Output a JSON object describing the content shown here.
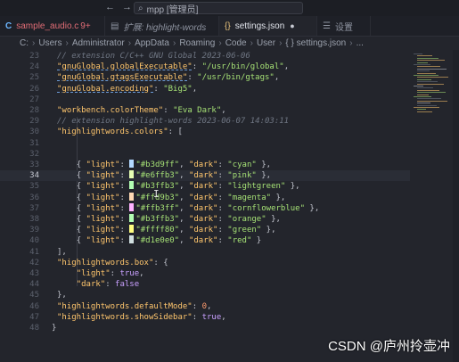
{
  "titlebar": {
    "nav_back": "←",
    "nav_forward": "→",
    "search_icon": "search-icon",
    "search_text": "mpp [管理员]"
  },
  "tabs": [
    {
      "label": "sample_audio.c",
      "badge": "9+",
      "icon": "c-file-icon",
      "color": "#e06c75"
    },
    {
      "label": "扩展: highlight-words",
      "icon": "extension-icon",
      "italic": true
    },
    {
      "label": "settings.json",
      "icon": "json-icon",
      "modified": "●",
      "active": true
    },
    {
      "label": "设置",
      "icon": "settings-icon"
    }
  ],
  "breadcrumb": [
    "C:",
    "Users",
    "Administrator",
    "AppData",
    "Roaming",
    "Code",
    "User",
    "{ } settings.json",
    "..."
  ],
  "colors": {
    "key": "#ffc66d",
    "string": "#a5e075",
    "comment": "#6f7683",
    "number": "#ff9d6e",
    "keyword": "#c9a0ff",
    "background": "#23252c"
  },
  "lines": [
    {
      "n": "23",
      "parts": [
        {
          "t": "// extension C/C++ GNU Global 2023-06-06",
          "c": "com"
        }
      ]
    },
    {
      "n": "24",
      "parts": [
        {
          "t": "\"gnuGlobal.globalExecutable\"",
          "c": "key"
        },
        {
          "t": ": ",
          "c": "punc"
        },
        {
          "t": "\"/usr/bin/global\"",
          "c": "str"
        },
        {
          "t": ",",
          "c": "punc"
        }
      ]
    },
    {
      "n": "25",
      "parts": [
        {
          "t": "\"gnuGlobal.gtagsExecutable\"",
          "c": "key"
        },
        {
          "t": ": ",
          "c": "punc"
        },
        {
          "t": "\"/usr/bin/gtags\"",
          "c": "str"
        },
        {
          "t": ",",
          "c": "punc"
        }
      ]
    },
    {
      "n": "26",
      "parts": [
        {
          "t": "\"gnuGlobal.encoding\"",
          "c": "key"
        },
        {
          "t": ": ",
          "c": "punc"
        },
        {
          "t": "\"Big5\"",
          "c": "str"
        },
        {
          "t": ",",
          "c": "punc"
        }
      ]
    },
    {
      "n": "27",
      "parts": []
    },
    {
      "n": "28",
      "parts": [
        {
          "t": "\"workbench.colorTheme\"",
          "c": "key"
        },
        {
          "t": ": ",
          "c": "punc"
        },
        {
          "t": "\"Eva Dark\"",
          "c": "str"
        },
        {
          "t": ",",
          "c": "punc"
        }
      ]
    },
    {
      "n": "29",
      "parts": [
        {
          "t": "// extension highlight-words 2023-06-07 14:03:11",
          "c": "com"
        }
      ]
    },
    {
      "n": "30",
      "parts": [
        {
          "t": "\"highlightwords.colors\"",
          "c": "key"
        },
        {
          "t": ": [",
          "c": "punc"
        }
      ]
    },
    {
      "n": "31",
      "parts": []
    },
    {
      "n": "32",
      "parts": []
    },
    {
      "n": "33",
      "indent": "    ",
      "swatch": "#b3d9ff",
      "parts": [
        {
          "t": "{ ",
          "c": "punc"
        },
        {
          "t": "\"light\"",
          "c": "key"
        },
        {
          "t": ": ",
          "c": "punc"
        },
        {
          "t": "\"#b3d9ff\"",
          "c": "str"
        },
        {
          "t": ", ",
          "c": "punc"
        },
        {
          "t": "\"dark\"",
          "c": "key"
        },
        {
          "t": ": ",
          "c": "punc"
        },
        {
          "t": "\"cyan\"",
          "c": "str"
        },
        {
          "t": " },",
          "c": "punc"
        }
      ]
    },
    {
      "n": "34",
      "current": true,
      "indent": "    ",
      "swatch": "#e6ffb3",
      "parts": [
        {
          "t": "{ ",
          "c": "punc"
        },
        {
          "t": "\"light\"",
          "c": "key"
        },
        {
          "t": ": ",
          "c": "punc"
        },
        {
          "t": "\"#e6ffb3\"",
          "c": "str"
        },
        {
          "t": ", ",
          "c": "punc"
        },
        {
          "t": "\"dark\"",
          "c": "key"
        },
        {
          "t": ": ",
          "c": "punc"
        },
        {
          "t": "\"pink\"",
          "c": "str"
        },
        {
          "t": " },",
          "c": "punc"
        }
      ]
    },
    {
      "n": "35",
      "indent": "    ",
      "swatch": "#b3ffb3",
      "parts": [
        {
          "t": "{ ",
          "c": "punc"
        },
        {
          "t": "\"light\"",
          "c": "key"
        },
        {
          "t": ": ",
          "c": "punc"
        },
        {
          "t": "\"#b3ffb3\"",
          "c": "str"
        },
        {
          "t": ", ",
          "c": "punc"
        },
        {
          "t": "\"dark\"",
          "c": "key"
        },
        {
          "t": ": ",
          "c": "punc"
        },
        {
          "t": "\"lightgreen\"",
          "c": "str"
        },
        {
          "t": " },",
          "c": "punc"
        }
      ]
    },
    {
      "n": "36",
      "indent": "    ",
      "swatch": "#ffd9b3",
      "parts": [
        {
          "t": "{ ",
          "c": "punc"
        },
        {
          "t": "\"light\"",
          "c": "key"
        },
        {
          "t": ": ",
          "c": "punc"
        },
        {
          "t": "\"#ffd9b3\"",
          "c": "str"
        },
        {
          "t": ", ",
          "c": "punc"
        },
        {
          "t": "\"dark\"",
          "c": "key"
        },
        {
          "t": ": ",
          "c": "punc"
        },
        {
          "t": "\"magenta\"",
          "c": "str"
        },
        {
          "t": " },",
          "c": "punc"
        }
      ]
    },
    {
      "n": "37",
      "indent": "    ",
      "swatch": "#ffb3ff",
      "parts": [
        {
          "t": "{ ",
          "c": "punc"
        },
        {
          "t": "\"light\"",
          "c": "key"
        },
        {
          "t": ": ",
          "c": "punc"
        },
        {
          "t": "\"#ffb3ff\"",
          "c": "str"
        },
        {
          "t": ", ",
          "c": "punc"
        },
        {
          "t": "\"dark\"",
          "c": "key"
        },
        {
          "t": ": ",
          "c": "punc"
        },
        {
          "t": "\"cornflowerblue\"",
          "c": "str"
        },
        {
          "t": " },",
          "c": "punc"
        }
      ]
    },
    {
      "n": "38",
      "indent": "    ",
      "swatch": "#b3ffb3",
      "parts": [
        {
          "t": "{ ",
          "c": "punc"
        },
        {
          "t": "\"light\"",
          "c": "key"
        },
        {
          "t": ": ",
          "c": "punc"
        },
        {
          "t": "\"#b3ffb3\"",
          "c": "str"
        },
        {
          "t": ", ",
          "c": "punc"
        },
        {
          "t": "\"dark\"",
          "c": "key"
        },
        {
          "t": ": ",
          "c": "punc"
        },
        {
          "t": "\"orange\"",
          "c": "str"
        },
        {
          "t": " },",
          "c": "punc"
        }
      ]
    },
    {
      "n": "39",
      "indent": "    ",
      "swatch": "#ffff80",
      "parts": [
        {
          "t": "{ ",
          "c": "punc"
        },
        {
          "t": "\"light\"",
          "c": "key"
        },
        {
          "t": ": ",
          "c": "punc"
        },
        {
          "t": "\"#ffff80\"",
          "c": "str"
        },
        {
          "t": ", ",
          "c": "punc"
        },
        {
          "t": "\"dark\"",
          "c": "key"
        },
        {
          "t": ": ",
          "c": "punc"
        },
        {
          "t": "\"green\"",
          "c": "str"
        },
        {
          "t": " },",
          "c": "punc"
        }
      ]
    },
    {
      "n": "40",
      "indent": "    ",
      "swatch": "#d1e0e0",
      "parts": [
        {
          "t": "{ ",
          "c": "punc"
        },
        {
          "t": "\"light\"",
          "c": "key"
        },
        {
          "t": ": ",
          "c": "punc"
        },
        {
          "t": "\"#d1e0e0\"",
          "c": "str"
        },
        {
          "t": ", ",
          "c": "punc"
        },
        {
          "t": "\"dark\"",
          "c": "key"
        },
        {
          "t": ": ",
          "c": "punc"
        },
        {
          "t": "\"red\"",
          "c": "str"
        },
        {
          "t": " }",
          "c": "punc"
        }
      ]
    },
    {
      "n": "41",
      "parts": [
        {
          "t": "],",
          "c": "punc"
        }
      ]
    },
    {
      "n": "42",
      "parts": [
        {
          "t": "\"highlightwords.box\"",
          "c": "key"
        },
        {
          "t": ": {",
          "c": "punc"
        }
      ]
    },
    {
      "n": "43",
      "indent": "    ",
      "parts": [
        {
          "t": "\"light\"",
          "c": "key"
        },
        {
          "t": ": ",
          "c": "punc"
        },
        {
          "t": "true",
          "c": "kw"
        },
        {
          "t": ",",
          "c": "punc"
        }
      ]
    },
    {
      "n": "44",
      "indent": "    ",
      "parts": [
        {
          "t": "\"dark\"",
          "c": "key"
        },
        {
          "t": ": ",
          "c": "punc"
        },
        {
          "t": "false",
          "c": "kw"
        }
      ]
    },
    {
      "n": "45",
      "parts": [
        {
          "t": "},",
          "c": "punc"
        }
      ]
    },
    {
      "n": "46",
      "parts": [
        {
          "t": "\"highlightwords.defaultMode\"",
          "c": "key"
        },
        {
          "t": ": ",
          "c": "punc"
        },
        {
          "t": "0",
          "c": "num"
        },
        {
          "t": ",",
          "c": "punc"
        }
      ]
    },
    {
      "n": "47",
      "parts": [
        {
          "t": "\"highlightwords.showSidebar\"",
          "c": "key"
        },
        {
          "t": ": ",
          "c": "punc"
        },
        {
          "t": "true",
          "c": "kw"
        },
        {
          "t": ",",
          "c": "punc"
        }
      ]
    },
    {
      "n": "48",
      "outdent": true,
      "parts": [
        {
          "t": "}",
          "c": "punc"
        }
      ]
    }
  ],
  "watermark": "CSDN @庐州拎壶冲"
}
